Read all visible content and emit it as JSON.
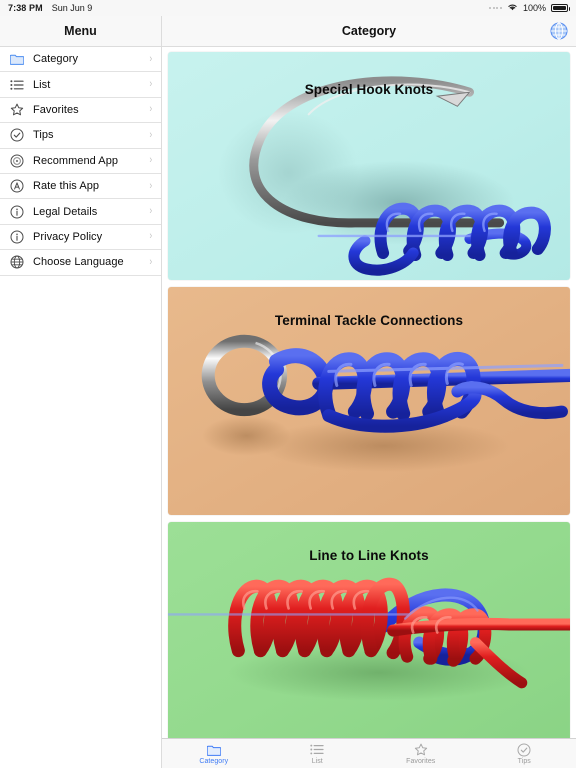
{
  "statusbar": {
    "time": "7:38 PM",
    "date": "Sun Jun 9",
    "battery_percent": "100%",
    "wifi_icon": "wifi-icon",
    "battery_icon": "battery-full-icon",
    "signal_icon": "signal-dots-icon"
  },
  "sidebar": {
    "header_title": "Menu",
    "items": [
      {
        "label": "Category",
        "icon": "folder-icon",
        "chevron": "›"
      },
      {
        "label": "List",
        "icon": "list-icon",
        "chevron": "›"
      },
      {
        "label": "Favorites",
        "icon": "star-icon",
        "chevron": "›"
      },
      {
        "label": "Tips",
        "icon": "check-circle-icon",
        "chevron": "›"
      },
      {
        "label": "Recommend App",
        "icon": "recommend-icon",
        "chevron": "›"
      },
      {
        "label": "Rate this App",
        "icon": "rate-circle-icon",
        "chevron": "›"
      },
      {
        "label": "Legal Details",
        "icon": "info-circle-icon",
        "chevron": "›"
      },
      {
        "label": "Privacy Policy",
        "icon": "info-circle-icon",
        "chevron": "›"
      },
      {
        "label": "Choose Language",
        "icon": "globe-icon",
        "chevron": "›"
      }
    ]
  },
  "navbar": {
    "title": "Category",
    "language_button_icon": "globe-icon"
  },
  "cards": [
    {
      "title": "Special Hook Knots",
      "background_color": "#bdeeea",
      "artwork": "fishing-hook-with-blue-line-knot"
    },
    {
      "title": "Terminal Tackle Connections",
      "background_color": "#e3b183",
      "artwork": "metal-ring-with-blue-line-knot"
    },
    {
      "title": "Line to Line Knots",
      "background_color": "#94da8e",
      "artwork": "red-and-blue-line-joining-knot"
    }
  ],
  "tabbar": {
    "active_color": "#3e7bf5",
    "inactive_color": "#9a9a9a",
    "tabs": [
      {
        "label": "Category",
        "icon": "folder-icon",
        "active": true
      },
      {
        "label": "List",
        "icon": "list-icon",
        "active": false
      },
      {
        "label": "Favorites",
        "icon": "star-icon",
        "active": false
      },
      {
        "label": "Tips",
        "icon": "check-circle-icon",
        "active": false
      }
    ]
  }
}
